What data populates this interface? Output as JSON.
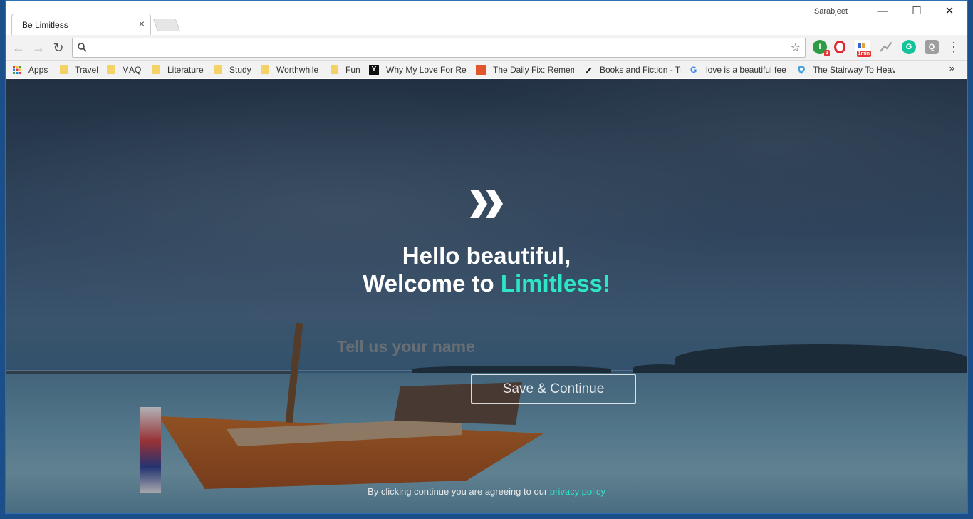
{
  "browser": {
    "tab_title": "Be Limitless",
    "tab_close": "×",
    "profile_name": "Sarabjeet",
    "window_controls": {
      "minimize": "—",
      "maximize": "☐",
      "close": "✕"
    },
    "nav": {
      "back": "←",
      "forward": "→",
      "reload": "↻"
    },
    "omnibox": {
      "value": "",
      "placeholder": ""
    },
    "star_icon": "☆",
    "extensions": [
      {
        "name": "ext-1",
        "letter": "I",
        "color": "#2e9b47",
        "badge": "1"
      },
      {
        "name": "opera-icon",
        "letter": "O",
        "color": "#e0272f",
        "badge": ""
      },
      {
        "name": "1min-icon",
        "letter": "",
        "color": "#ffffff",
        "badge": "1min"
      },
      {
        "name": "pulse-icon",
        "letter": "",
        "color": "#ffffff",
        "badge": ""
      },
      {
        "name": "grammarly-icon",
        "letter": "G",
        "color": "#15c39a",
        "badge": ""
      },
      {
        "name": "q-icon",
        "letter": "Q",
        "color": "#9e9e9e",
        "badge": ""
      }
    ],
    "menu": "⋮",
    "bookmarks": {
      "items": [
        "Apps",
        "Travel",
        "MAQ",
        "Literature",
        "Study",
        "Worthwhile",
        "Fun",
        "Why My Love For Rea",
        "The Daily Fix: Remem",
        "Books and Fiction - Th",
        "love is a beautiful fee",
        "The Stairway To Heav"
      ],
      "more": "»"
    }
  },
  "page": {
    "headline_line1": "Hello beautiful,",
    "headline_line2_prefix": "Welcome to ",
    "headline_line2_accent": "Limitless!",
    "name_placeholder": "Tell us your name",
    "save_label": "Save & Continue",
    "footnote_prefix": "By clicking continue you are agreeing to our ",
    "footnote_link": "privacy policy",
    "accent_color": "#2ee6c5"
  }
}
